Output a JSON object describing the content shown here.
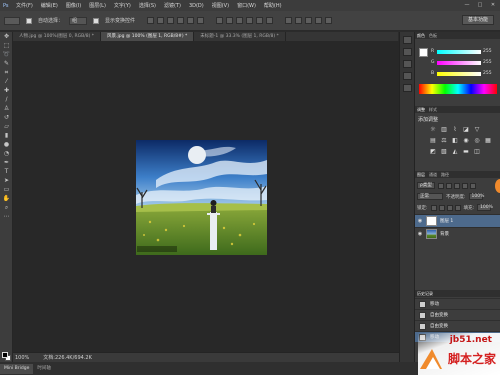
{
  "menubar": {
    "logo": "Ps",
    "items": [
      "文件(F)",
      "编辑(E)",
      "图像(I)",
      "图层(L)",
      "文字(Y)",
      "选择(S)",
      "滤镜(T)",
      "3D(D)",
      "视图(V)",
      "窗口(W)",
      "帮助(H)"
    ],
    "window_buttons": [
      "—",
      "□",
      "✕"
    ]
  },
  "options_bar": {
    "auto_select_label": "自动选择：",
    "auto_select_value": "组",
    "show_transform_label": "显示变换控件",
    "workspace_label": "基本功能"
  },
  "doc_tabs": [
    {
      "label": "人物.jpg @ 100%(图层 0, RGB/8) *",
      "active": false
    },
    {
      "label": "风景.jpg @ 100% (图层 1, RGB/8#) *",
      "active": true
    },
    {
      "label": "未标题-1 @ 33.3% (图层 1, RGB/8) *",
      "active": false
    }
  ],
  "status_bar": {
    "zoom": "100%",
    "doc_info": "文档:226.4K/694.2K"
  },
  "bottom_tabs": [
    {
      "label": "Mini Bridge",
      "active": true
    },
    {
      "label": "时间轴",
      "active": false
    }
  ],
  "color_panel": {
    "tabs": [
      "颜色",
      "色板"
    ],
    "channels": [
      {
        "name": "R",
        "value": "255"
      },
      {
        "name": "G",
        "value": "255"
      },
      {
        "name": "B",
        "value": "255"
      }
    ],
    "colors": {
      "r_bar": "#e23b7a",
      "g_bar": "#a33bd1",
      "b_bar": "#3e5ad8"
    }
  },
  "adjustments_panel": {
    "tabs": [
      "调整",
      "样式"
    ],
    "title": "添加调整"
  },
  "layers_panel": {
    "tabs": [
      "图层",
      "通道",
      "路径"
    ],
    "filter_label": "ρ类型",
    "blend_mode": "正常",
    "opacity_label": "不透明度:",
    "opacity_value": "100%",
    "lock_label": "锁定:",
    "fill_label": "填充:",
    "fill_value": "100%",
    "layers": [
      {
        "name": "图层 1",
        "selected": true
      },
      {
        "name": "背景",
        "selected": false
      }
    ]
  },
  "history_panel": {
    "tabs": [
      "历史记录"
    ],
    "items": [
      {
        "label": "移动",
        "selected": false
      },
      {
        "label": "自由变换",
        "selected": false
      },
      {
        "label": "自由变换",
        "selected": false
      },
      {
        "label": "移动",
        "selected": true
      }
    ]
  },
  "watermark": {
    "url": "jb51.net",
    "site": "脚本之家"
  }
}
